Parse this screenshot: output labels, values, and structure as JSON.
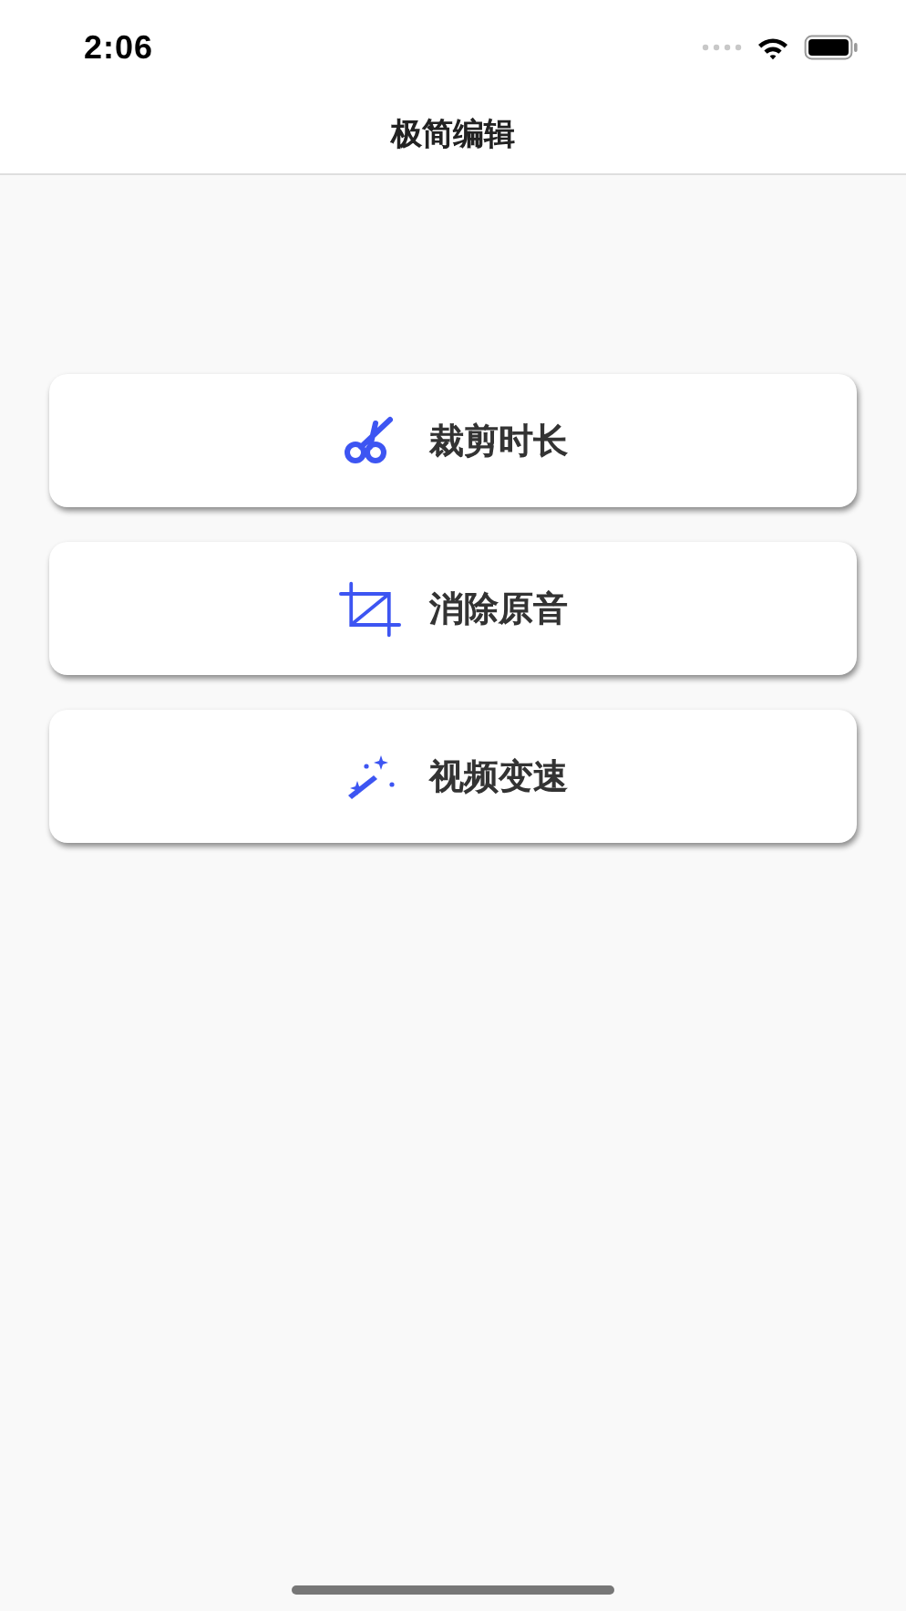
{
  "status_bar": {
    "time": "2:06"
  },
  "nav_bar": {
    "title": "极简编辑"
  },
  "actions": [
    {
      "kind": "scissors",
      "label": "裁剪时长"
    },
    {
      "kind": "crop",
      "label": "消除原音"
    },
    {
      "kind": "wand",
      "label": "视频变速"
    }
  ]
}
